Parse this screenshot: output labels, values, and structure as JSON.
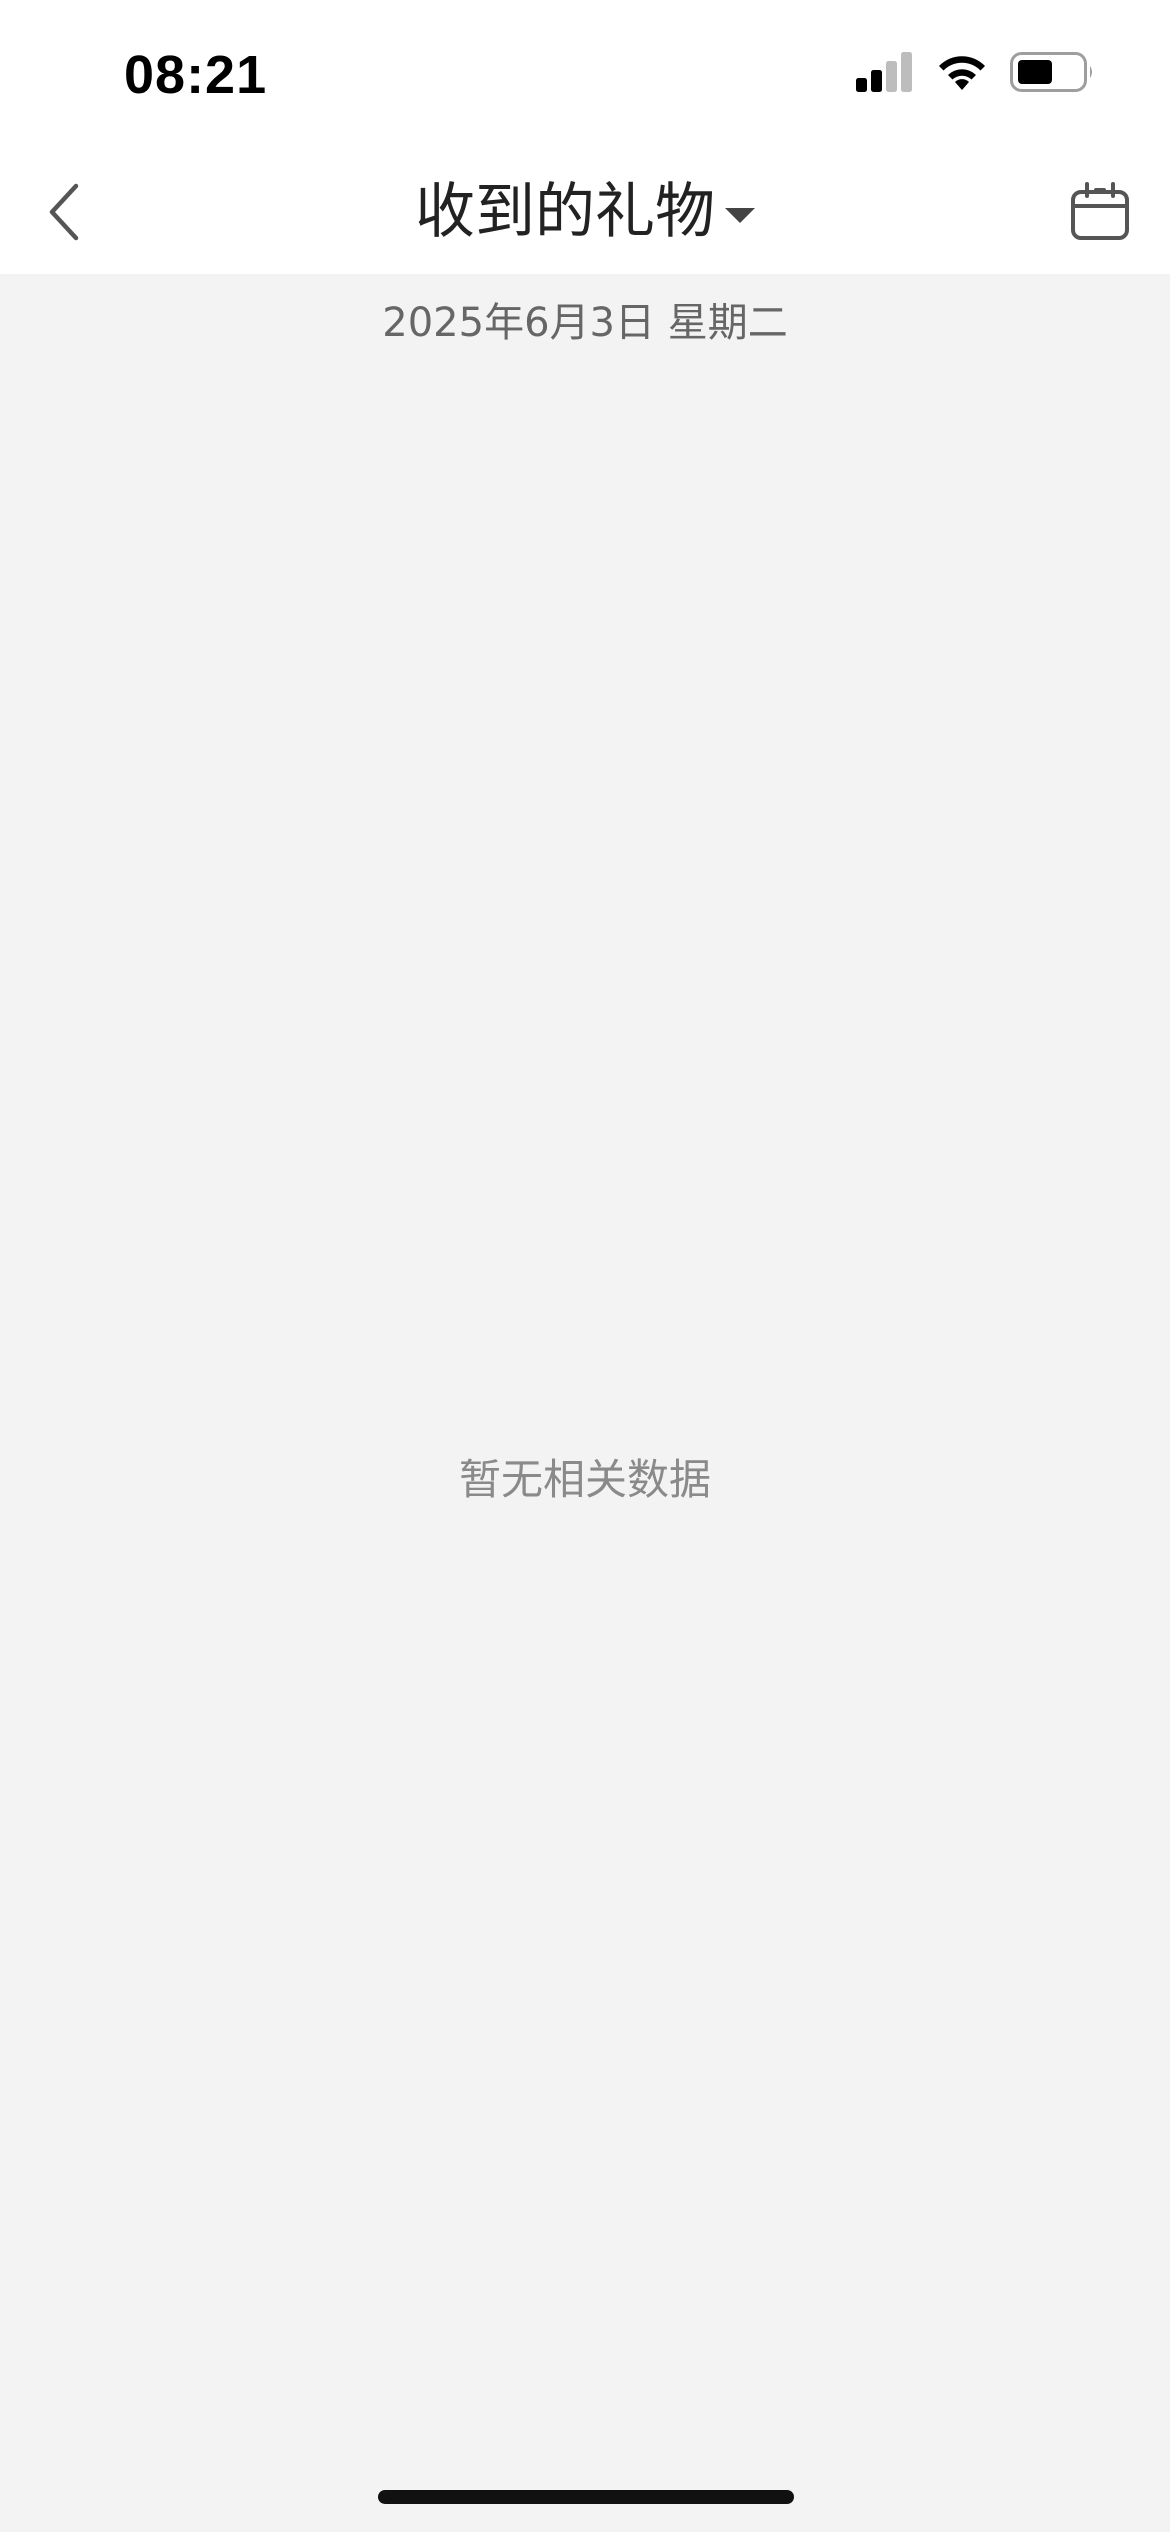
{
  "status_bar": {
    "time": "08:21",
    "icons": [
      "signal-icon",
      "wifi-icon",
      "battery-icon"
    ]
  },
  "nav": {
    "back_icon": "chevron-left-icon",
    "title": "收到的礼物",
    "title_dropdown_icon": "caret-down-icon",
    "calendar_icon": "calendar-icon"
  },
  "date_label": "2025年6月3日 星期二",
  "empty_state": {
    "message": "暂无相关数据"
  },
  "colors": {
    "background": "#f3f3f3",
    "header_background": "#ffffff",
    "title_text": "#222222",
    "secondary_text": "#666666",
    "empty_text": "#8a8a8a"
  }
}
